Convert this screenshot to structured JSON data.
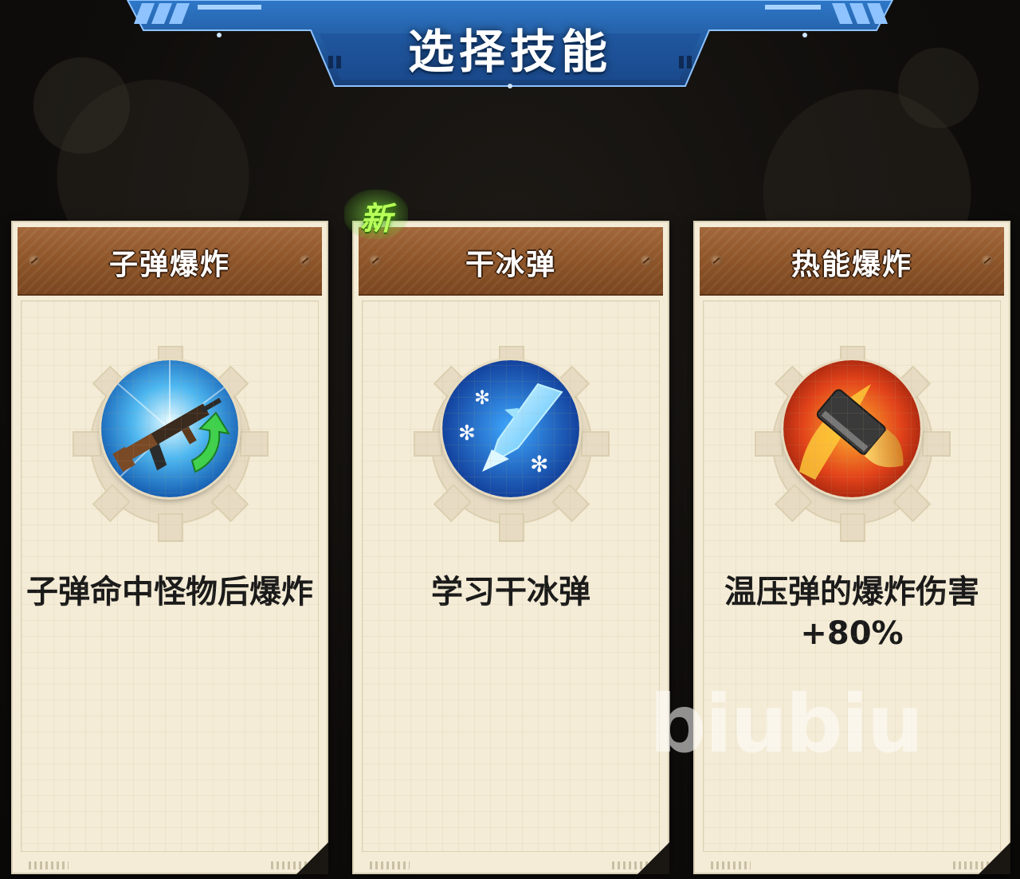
{
  "screen_title": "选择技能",
  "cards": [
    {
      "title": "子弹爆炸",
      "icon": "rifle-upgrade-icon",
      "description": "子弹命中怪物后爆炸",
      "is_new": false
    },
    {
      "title": "干冰弹",
      "icon": "ice-bullet-icon",
      "description": "学习干冰弹",
      "is_new": true,
      "new_label": "新"
    },
    {
      "title": "热能爆炸",
      "icon": "fire-bullet-icon",
      "description": "温压弹的爆炸伤害+80%",
      "is_new": false
    }
  ],
  "watermark": "biubiu",
  "colors": {
    "banner_blue": "#1f5fae",
    "card_paper": "#f4ecd6",
    "card_header": "#8b5327",
    "new_badge": "#b9ff5a"
  }
}
